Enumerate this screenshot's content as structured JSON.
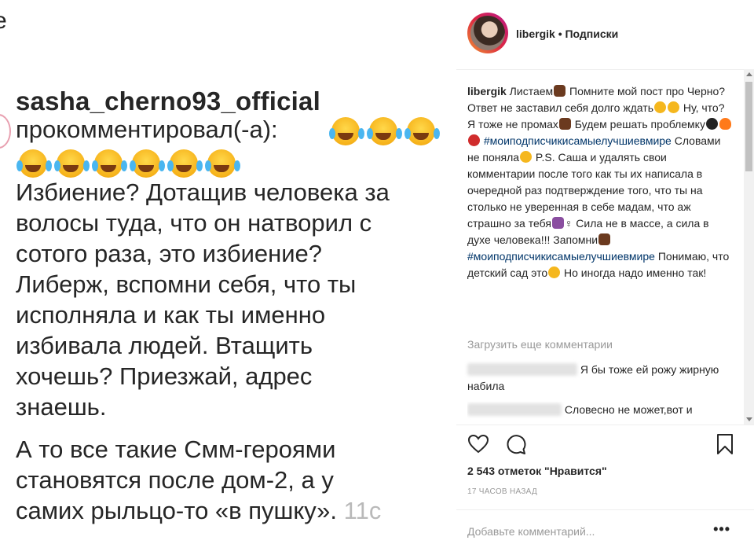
{
  "left_image": {
    "edge_char": "e",
    "username": "sasha_cherno93_official",
    "commented_label": "прокомментировал(-а):",
    "body_paragraph1": "Избиение? Дотащив человека за\nволосы туда, что он натворил с\nсотого раза, это избиение?\nЛиберж, вспомни себя, что ты\nисполняла и как ты именно\nизбивала людей. Втащить\nхочешь? Приезжай, адрес\nзнаешь.",
    "body_paragraph2": "А то все такие Смм-героями\nстановятся после дом-2, а у\nсамих рыльцо-то «в пушку».",
    "timestamp": "11с"
  },
  "post": {
    "username": "libergik",
    "separator": "•",
    "follow_label": "Подписки",
    "caption": {
      "author": "libergik",
      "t1": " Листаем",
      "t2": " Помните мой пост про Черно? Ответ не заставил себя долго ждать",
      "t3": " Ну, что? Я тоже не промах",
      "t4": " Будем решать проблемку",
      "hashtag1": "#моиподписчикисамыелучшиевмире",
      "t5": " Словами не поняла",
      "t6": " P.S. Саша и удалять свои комментарии после того как ты их написала в очередной раз подтверждение того, что ты на столько не уверенная в себе мадам, что аж страшно за тебя",
      "t7": "♀ Сила не в массе, а сила в духе человека!!! Запомни",
      "hashtag2": "#моиподписчикисамыелучшиевмире",
      "t8": " Понимаю, что детский сад это",
      "t9": "  Но иногда надо именно так!"
    },
    "load_more": "Загрузить еще комментарии",
    "comments": [
      {
        "text": " Я бы тоже ей рожу жирную набила"
      },
      {
        "text": " Словесно не может,вот и"
      }
    ],
    "likes": "2 543 отметок \"Нравится\"",
    "time": "17 ЧАСОВ НАЗАД",
    "add_comment_placeholder": "Добавьте комментарий...",
    "more_label": "•••",
    "icons": [
      "heart-icon",
      "comment-icon",
      "bookmark-icon"
    ]
  }
}
